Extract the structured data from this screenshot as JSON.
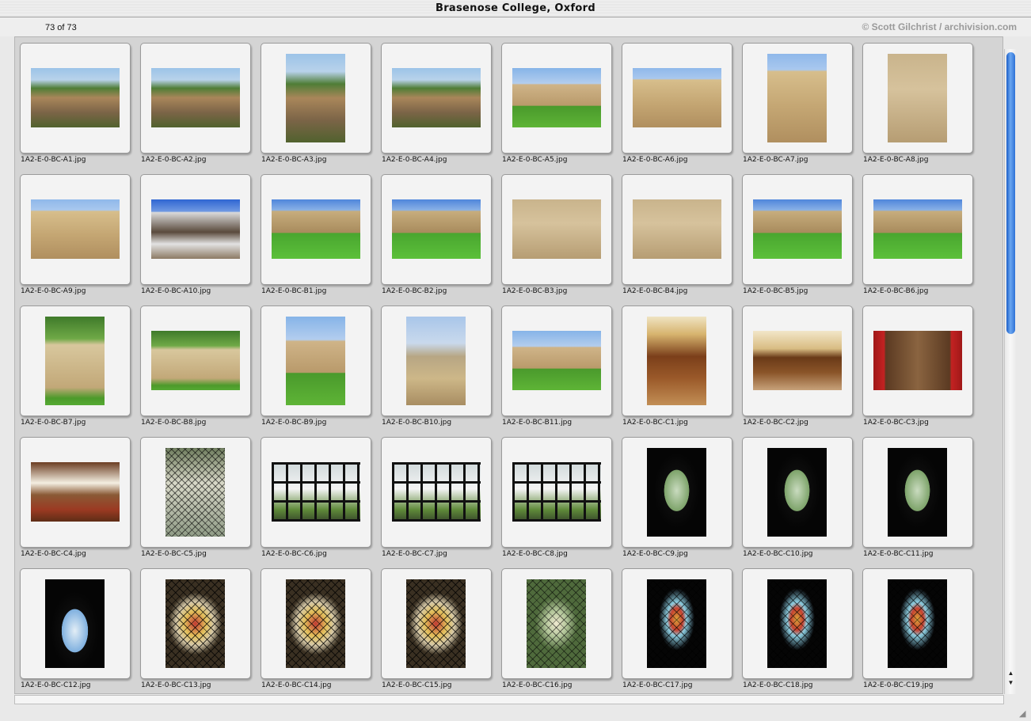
{
  "window": {
    "title": "Brasenose College, Oxford"
  },
  "header": {
    "count": "73 of 73",
    "credit": "© Scott Gilchrist / archivision.com"
  },
  "scroll": {
    "arrow_up": "▲",
    "arrow_down": "▼",
    "grow": "◢"
  },
  "slides": [
    {
      "file": "1A2-E-0-BC-A1.jpg",
      "orient": "landscape",
      "scene": "aerial",
      "icon": "aerial-view-icon"
    },
    {
      "file": "1A2-E-0-BC-A2.jpg",
      "orient": "landscape",
      "scene": "aerial",
      "icon": "aerial-view-icon"
    },
    {
      "file": "1A2-E-0-BC-A3.jpg",
      "orient": "portrait",
      "scene": "aerial",
      "icon": "aerial-view-icon"
    },
    {
      "file": "1A2-E-0-BC-A4.jpg",
      "orient": "landscape",
      "scene": "aerial",
      "icon": "aerial-view-icon"
    },
    {
      "file": "1A2-E-0-BC-A5.jpg",
      "orient": "landscape",
      "scene": "quad",
      "icon": "quadrangle-icon"
    },
    {
      "file": "1A2-E-0-BC-A6.jpg",
      "orient": "landscape",
      "scene": "facade",
      "icon": "facade-icon"
    },
    {
      "file": "1A2-E-0-BC-A7.jpg",
      "orient": "portrait",
      "scene": "facade",
      "icon": "facade-icon"
    },
    {
      "file": "1A2-E-0-BC-A8.jpg",
      "orient": "portrait",
      "scene": "stone",
      "icon": "facade-icon"
    },
    {
      "file": "1A2-E-0-BC-A9.jpg",
      "orient": "landscape",
      "scene": "facade",
      "icon": "facade-icon"
    },
    {
      "file": "1A2-E-0-BC-A10.jpg",
      "orient": "landscape",
      "scene": "tudor",
      "icon": "facade-icon"
    },
    {
      "file": "1A2-E-0-BC-B1.jpg",
      "orient": "landscape",
      "scene": "lawn",
      "icon": "quadrangle-icon"
    },
    {
      "file": "1A2-E-0-BC-B2.jpg",
      "orient": "landscape",
      "scene": "lawn",
      "icon": "quadrangle-icon"
    },
    {
      "file": "1A2-E-0-BC-B3.jpg",
      "orient": "landscape",
      "scene": "stone",
      "icon": "facade-icon"
    },
    {
      "file": "1A2-E-0-BC-B4.jpg",
      "orient": "landscape",
      "scene": "stone",
      "icon": "window-icon"
    },
    {
      "file": "1A2-E-0-BC-B5.jpg",
      "orient": "landscape",
      "scene": "lawn",
      "icon": "quadrangle-icon"
    },
    {
      "file": "1A2-E-0-BC-B6.jpg",
      "orient": "landscape",
      "scene": "lawn",
      "icon": "quadrangle-icon"
    },
    {
      "file": "1A2-E-0-BC-B7.jpg",
      "orient": "portrait",
      "scene": "tree",
      "icon": "tower-icon"
    },
    {
      "file": "1A2-E-0-BC-B8.jpg",
      "orient": "landscape",
      "scene": "tree",
      "icon": "gable-icon"
    },
    {
      "file": "1A2-E-0-BC-B9.jpg",
      "orient": "portrait",
      "scene": "quad",
      "icon": "tower-icon"
    },
    {
      "file": "1A2-E-0-BC-B10.jpg",
      "orient": "portrait",
      "scene": "dome",
      "icon": "dome-icon"
    },
    {
      "file": "1A2-E-0-BC-B11.jpg",
      "orient": "landscape",
      "scene": "quad",
      "icon": "quadrangle-icon"
    },
    {
      "file": "1A2-E-0-BC-C1.jpg",
      "orient": "portrait",
      "scene": "hall",
      "icon": "interior-icon"
    },
    {
      "file": "1A2-E-0-BC-C2.jpg",
      "orient": "landscape",
      "scene": "ceiling",
      "icon": "interior-icon"
    },
    {
      "file": "1A2-E-0-BC-C3.jpg",
      "orient": "landscape",
      "scene": "fire",
      "icon": "fireplace-icon"
    },
    {
      "file": "1A2-E-0-BC-C4.jpg",
      "orient": "landscape",
      "scene": "room",
      "icon": "interior-icon"
    },
    {
      "file": "1A2-E-0-BC-C5.jpg",
      "orient": "portrait",
      "scene": "leaded",
      "icon": "window-icon"
    },
    {
      "file": "1A2-E-0-BC-C6.jpg",
      "orient": "landscape",
      "scene": "windows",
      "icon": "window-icon"
    },
    {
      "file": "1A2-E-0-BC-C7.jpg",
      "orient": "landscape",
      "scene": "windows",
      "icon": "window-icon"
    },
    {
      "file": "1A2-E-0-BC-C8.jpg",
      "orient": "landscape",
      "scene": "windows",
      "icon": "window-icon"
    },
    {
      "file": "1A2-E-0-BC-C9.jpg",
      "orient": "portrait",
      "scene": "arch",
      "icon": "arched-window-icon"
    },
    {
      "file": "1A2-E-0-BC-C10.jpg",
      "orient": "portrait",
      "scene": "arch",
      "icon": "arched-window-icon"
    },
    {
      "file": "1A2-E-0-BC-C11.jpg",
      "orient": "portrait",
      "scene": "arch",
      "icon": "arched-window-icon"
    },
    {
      "file": "1A2-E-0-BC-C12.jpg",
      "orient": "portrait",
      "scene": "archsky",
      "icon": "arched-window-icon"
    },
    {
      "file": "1A2-E-0-BC-C13.jpg",
      "orient": "portrait",
      "scene": "glass",
      "icon": "stained-glass-icon"
    },
    {
      "file": "1A2-E-0-BC-C14.jpg",
      "orient": "portrait",
      "scene": "glass",
      "icon": "stained-glass-icon"
    },
    {
      "file": "1A2-E-0-BC-C15.jpg",
      "orient": "portrait",
      "scene": "glass",
      "icon": "stained-glass-icon"
    },
    {
      "file": "1A2-E-0-BC-C16.jpg",
      "orient": "portrait",
      "scene": "greenglass",
      "icon": "stained-glass-icon"
    },
    {
      "file": "1A2-E-0-BC-C17.jpg",
      "orient": "portrait",
      "scene": "blueglass",
      "icon": "stained-glass-icon"
    },
    {
      "file": "1A2-E-0-BC-C18.jpg",
      "orient": "portrait",
      "scene": "blueglass",
      "icon": "stained-glass-icon"
    },
    {
      "file": "1A2-E-0-BC-C19.jpg",
      "orient": "portrait",
      "scene": "blueglass",
      "icon": "stained-glass-icon"
    }
  ]
}
